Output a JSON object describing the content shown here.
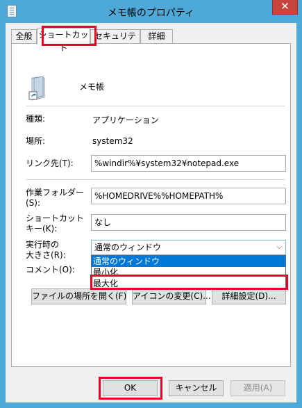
{
  "window": {
    "title": "メモ帳のプロパティ",
    "close_glyph": "✕"
  },
  "tabs": [
    "全般",
    "ショートカット",
    "セキュリティ",
    "詳細"
  ],
  "active_tab": "ショートカット",
  "target_name": "メモ帳",
  "fields": {
    "type_label": "種類:",
    "type_value": "アプリケーション",
    "location_label": "場所:",
    "location_value": "system32",
    "link_label": "リンク先(T):",
    "link_value": "%windir%¥system32¥notepad.exe",
    "workdir_label_1": "作業フォルダー",
    "workdir_label_2": "(S):",
    "workdir_value": "%HOMEDRIVE%%HOMEPATH%",
    "hotkey_label_1": "ショートカット",
    "hotkey_label_2": "キー(K):",
    "hotkey_value": "なし",
    "run_label_1": "実行時の",
    "run_label_2": "大きさ(R):",
    "run_value": "通常のウィンドウ",
    "comment_label": "コメント(O):"
  },
  "run_options": [
    "通常のウィンドウ",
    "最小化",
    "最大化"
  ],
  "run_selected_index": 0,
  "buttons": {
    "open_location": "ファイルの場所を開く(F)",
    "change_icon": "アイコンの変更(C)...",
    "advanced": "詳細設定(D)...",
    "ok": "OK",
    "cancel": "キャンセル",
    "apply": "適用(A)"
  },
  "colors": {
    "highlight": "#e8002a",
    "selection": "#0078d7",
    "title_bar": "#4ea9d8"
  }
}
